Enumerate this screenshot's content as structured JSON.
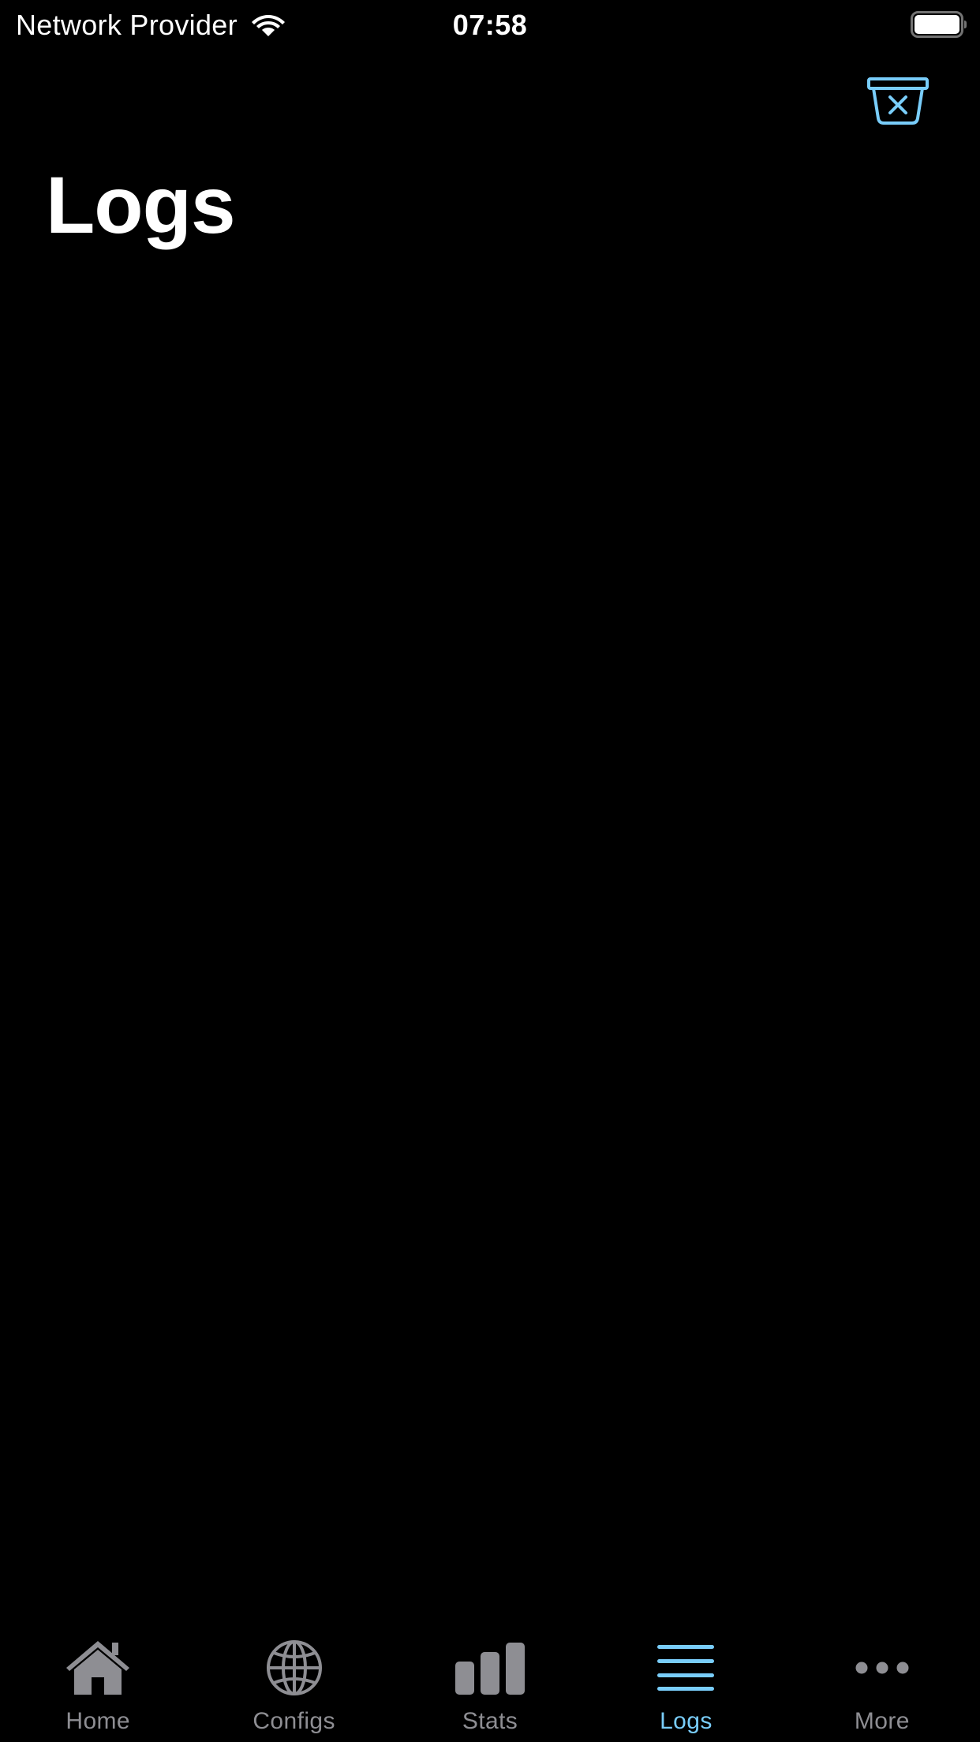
{
  "status_bar": {
    "carrier": "Network Provider",
    "time": "07:58",
    "wifi_icon": "wifi-icon",
    "battery_icon": "battery-icon"
  },
  "nav": {
    "clear_icon": "trash-clear-icon",
    "title": "Logs"
  },
  "colors": {
    "background": "#000000",
    "accent": "#79cdfa",
    "inactive": "#8e8e93",
    "text": "#ffffff"
  },
  "tab_bar": {
    "active": "Logs",
    "items": [
      {
        "label": "Home",
        "icon": "house-icon"
      },
      {
        "label": "Configs",
        "icon": "globe-icon"
      },
      {
        "label": "Stats",
        "icon": "bar-chart-icon"
      },
      {
        "label": "Logs",
        "icon": "list-icon"
      },
      {
        "label": "More",
        "icon": "ellipsis-icon"
      }
    ]
  }
}
